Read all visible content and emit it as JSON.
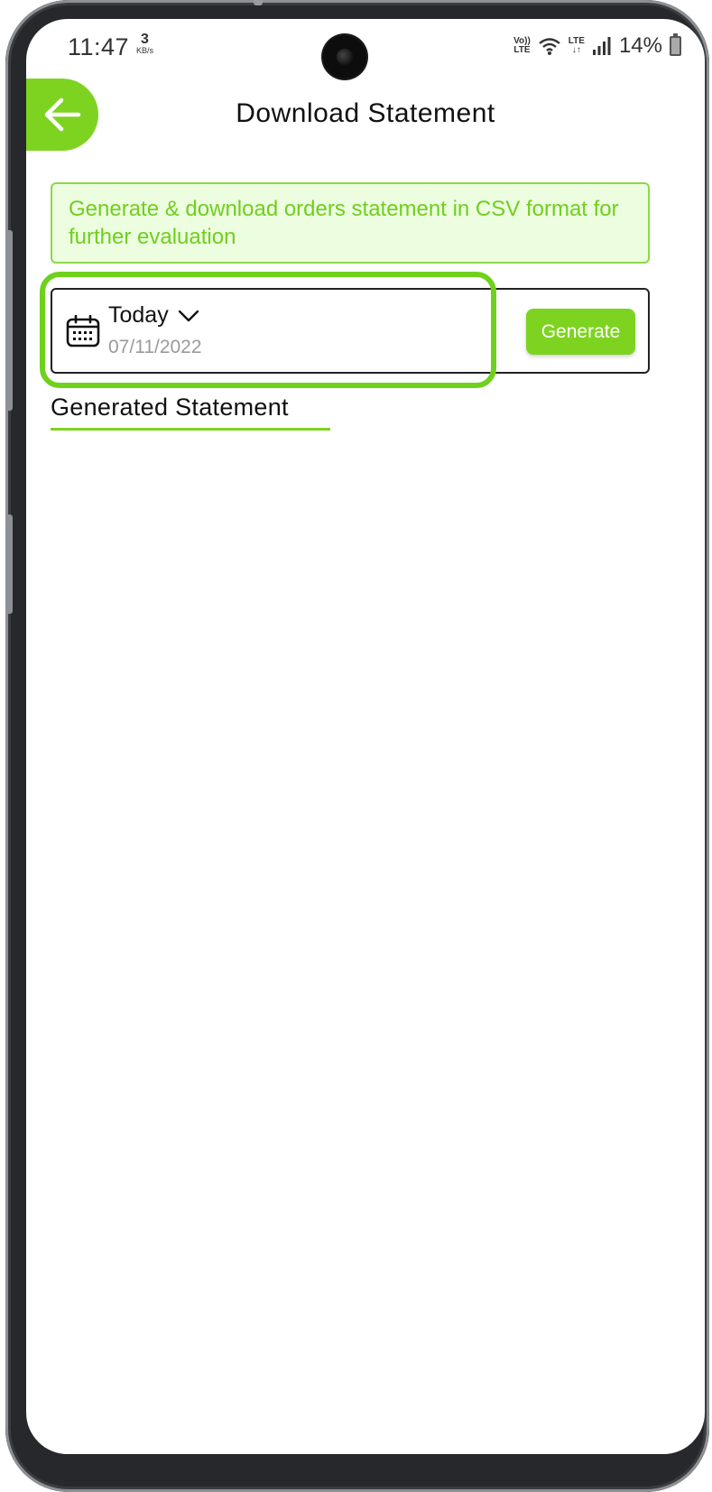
{
  "status_bar": {
    "time": "11:47",
    "net_speed": "3",
    "net_speed_unit": "KB/s",
    "volte_top": "Vo))",
    "volte_bottom": "LTE",
    "lte_label": "LTE",
    "lte_arrows": "↓↑",
    "battery_percent": "14%"
  },
  "header": {
    "title": "Download Statement",
    "back_icon": "arrow-left-icon"
  },
  "info_banner": {
    "text": "Generate & download orders statement in CSV format for further evaluation"
  },
  "date_filter": {
    "selected_period": "Today",
    "date": "07/11/2022",
    "calendar_icon": "calendar-icon",
    "dropdown_icon": "chevron-down-icon"
  },
  "actions": {
    "generate_label": "Generate"
  },
  "section": {
    "title": "Generated Statement"
  },
  "colors": {
    "accent": "#7ed321",
    "banner_bg": "#edfde0",
    "banner_text": "#6fcf1d",
    "highlight": "#6fd11d"
  }
}
